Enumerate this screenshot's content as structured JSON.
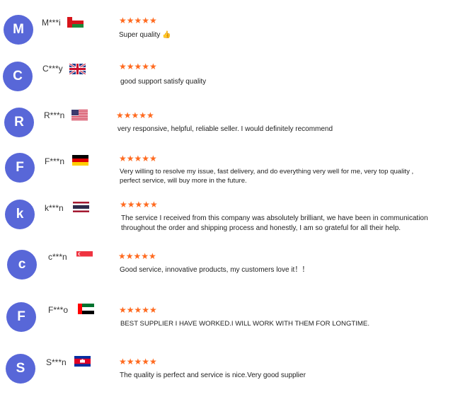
{
  "reviews": [
    {
      "initial": "M",
      "name": "M***i",
      "flag": "oman-flag",
      "stars": "★★★★★",
      "rating": 5,
      "lines": [
        "Super quality 👍"
      ]
    },
    {
      "initial": "C",
      "name": "C***y",
      "flag": "uk-flag",
      "stars": "★★★★★",
      "rating": 5,
      "lines": [
        "good support satisfy quality"
      ]
    },
    {
      "initial": "R",
      "name": "R***n",
      "flag": "usa-flag",
      "stars": "★★★★★",
      "rating": 5,
      "lines": [
        "very responsive, helpful, reliable seller. I would definitely recommend"
      ]
    },
    {
      "initial": "F",
      "name": "F***n",
      "flag": "germany-flag",
      "stars": "★★★★★",
      "rating": 5,
      "lines": [
        "Very willing to resolve my issue, fast delivery, and do everything very well for me, very top quality ,",
        "perfect service, will buy more in the future."
      ]
    },
    {
      "initial": "k",
      "name": "k***n",
      "flag": "thailand-flag",
      "stars": "★★★★★",
      "rating": 5,
      "lines": [
        "The service I received from this company was absolutely brilliant, we have been in communication",
        "throughout the order and shipping process and honestly, I am so grateful for all their help."
      ]
    },
    {
      "initial": "c",
      "name": "c***n",
      "flag": "singapore-flag",
      "stars": "★★★★★",
      "rating": 5,
      "lines": [
        "Good service, innovative products, my customers love it！！"
      ]
    },
    {
      "initial": "F",
      "name": "F***o",
      "flag": "uae-flag",
      "stars": "★★★★★",
      "rating": 5,
      "lines": [
        "BEST SUPPLIER I HAVE WORKED.I WILL WORK WITH THEM FOR LONGTIME."
      ]
    },
    {
      "initial": "S",
      "name": "S***n",
      "flag": "cambodia-flag",
      "stars": "★★★★★",
      "rating": 5,
      "lines": [
        "The quality is perfect and service is nice.Very good supplier"
      ]
    }
  ],
  "colors": {
    "avatar": "#5867d8",
    "stars": "#ff6a1f"
  }
}
